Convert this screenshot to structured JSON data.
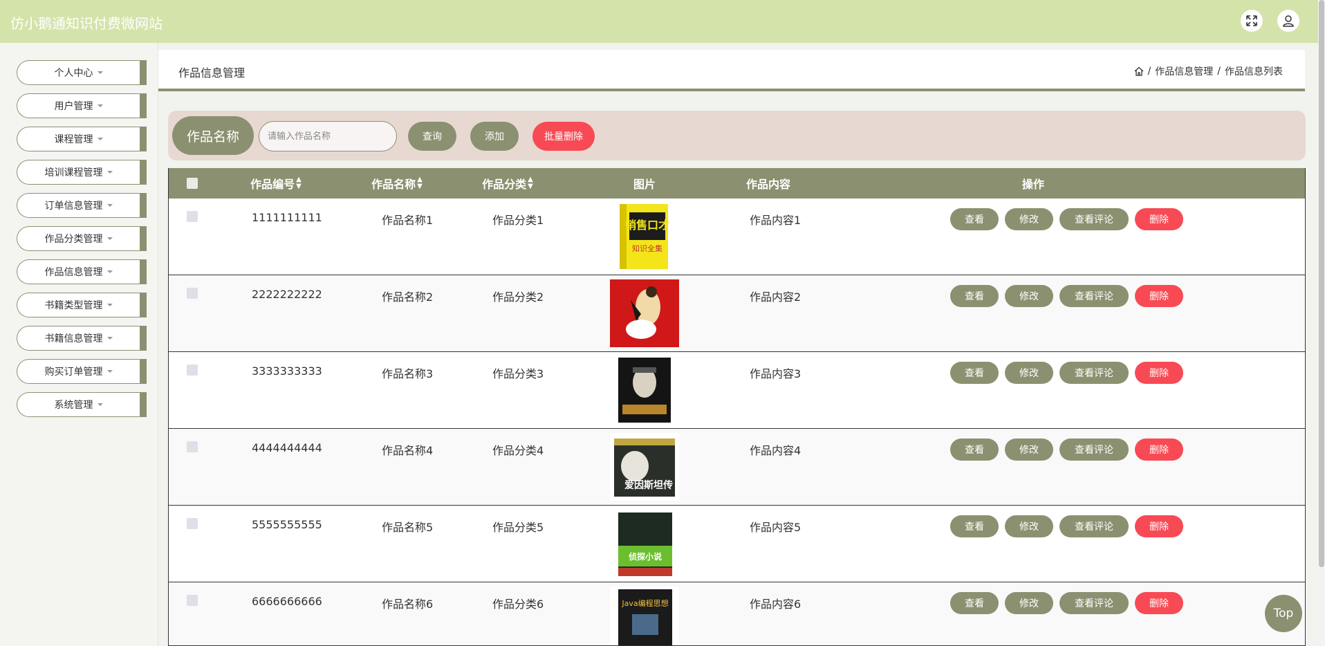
{
  "header": {
    "title": "仿小鹅通知识付费微网站"
  },
  "sidebar": {
    "items": [
      {
        "label": "个人中心"
      },
      {
        "label": "用户管理"
      },
      {
        "label": "课程管理"
      },
      {
        "label": "培训课程管理"
      },
      {
        "label": "订单信息管理"
      },
      {
        "label": "作品分类管理"
      },
      {
        "label": "作品信息管理"
      },
      {
        "label": "书籍类型管理"
      },
      {
        "label": "书籍信息管理"
      },
      {
        "label": "购买订单管理"
      },
      {
        "label": "系统管理"
      }
    ]
  },
  "breadcrumb": {
    "title": "作品信息管理",
    "sep": "/",
    "level1": "作品信息管理",
    "level2": "作品信息列表"
  },
  "search": {
    "label": "作品名称",
    "placeholder": "请输入作品名称",
    "query_btn": "查询",
    "add_btn": "添加",
    "batch_delete_btn": "批量删除"
  },
  "table": {
    "headers": {
      "code": "作品编号",
      "name": "作品名称",
      "category": "作品分类",
      "image": "图片",
      "content": "作品内容",
      "actions": "操作"
    },
    "actions": {
      "view": "查看",
      "edit": "修改",
      "comments": "查看评论",
      "delete": "删除"
    },
    "rows": [
      {
        "code": "1111111111",
        "name": "作品名称1",
        "category": "作品分类1",
        "content": "作品内容1",
        "cover_title": "销售口才",
        "cover_sub": "知识全集"
      },
      {
        "code": "2222222222",
        "name": "作品名称2",
        "category": "作品分类2",
        "content": "作品内容2"
      },
      {
        "code": "3333333333",
        "name": "作品名称3",
        "category": "作品分类3",
        "content": "作品内容3"
      },
      {
        "code": "4444444444",
        "name": "作品名称4",
        "category": "作品分类4",
        "content": "作品内容4",
        "cover_title": "爱因斯坦传"
      },
      {
        "code": "5555555555",
        "name": "作品名称5",
        "category": "作品分类5",
        "content": "作品内容5",
        "cover_title": "侦探小说"
      },
      {
        "code": "6666666666",
        "name": "作品名称6",
        "category": "作品分类6",
        "content": "作品内容6",
        "cover_title": "Java编程思想"
      }
    ]
  },
  "top_button": "Top",
  "colors": {
    "header_bg": "#d4e3aa",
    "primary": "#8b9170",
    "danger": "#f84a54",
    "search_bg": "#e8d8d2"
  }
}
